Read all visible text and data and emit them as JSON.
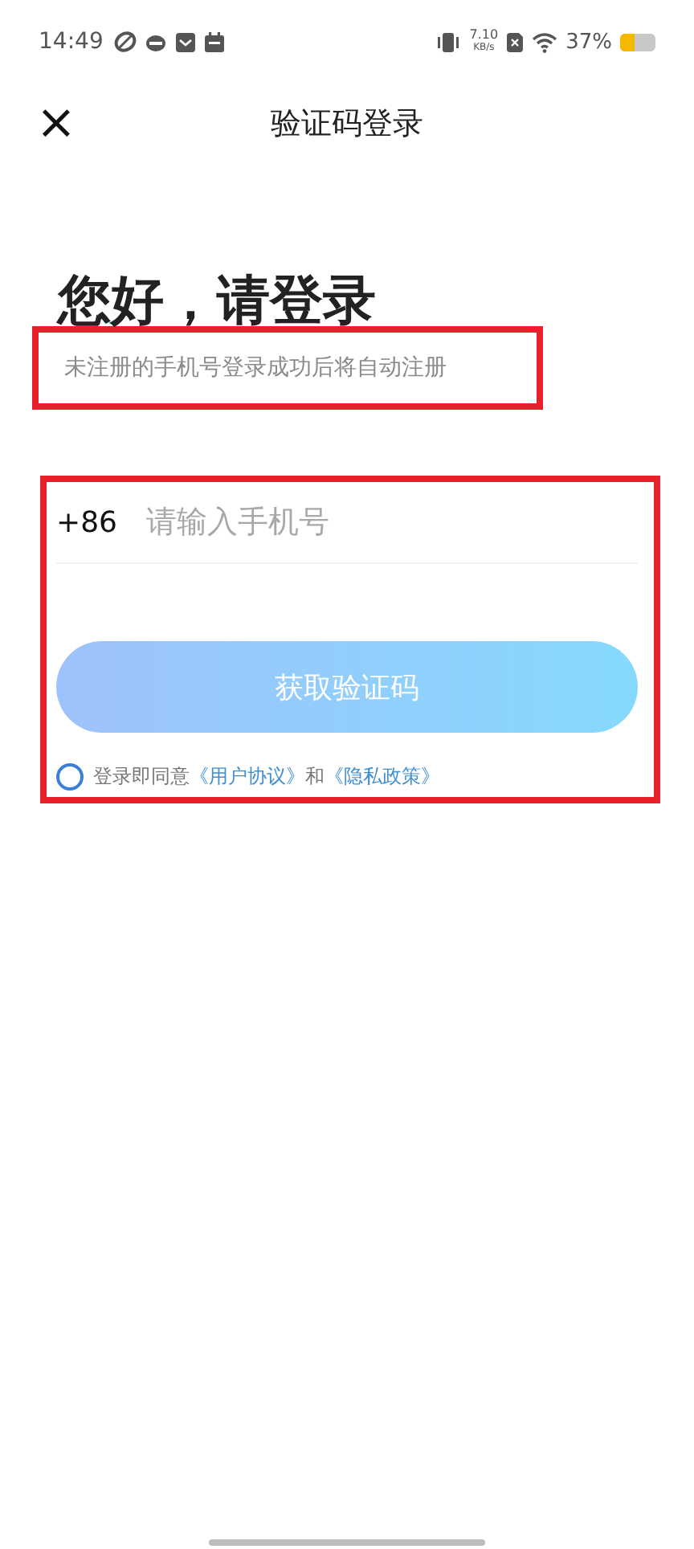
{
  "status_bar": {
    "time": "14:49",
    "speed_value": "7.10",
    "speed_unit": "KB/s",
    "battery": "37%"
  },
  "header": {
    "close": "×",
    "title": "验证码登录"
  },
  "greeting": "您好，请登录",
  "notice": {
    "text": "未注册的手机号登录成功后将自动注册",
    "highlighted": true
  },
  "form": {
    "highlighted": true,
    "country_code": "+86",
    "phone": {
      "placeholder": "请输入手机号"
    },
    "submit": "获取验证码",
    "agreement": {
      "checked": false,
      "lead": "登录即同意",
      "links": [
        "《用户协议》",
        "《隐私政策》"
      ],
      "joiner": "和"
    }
  }
}
